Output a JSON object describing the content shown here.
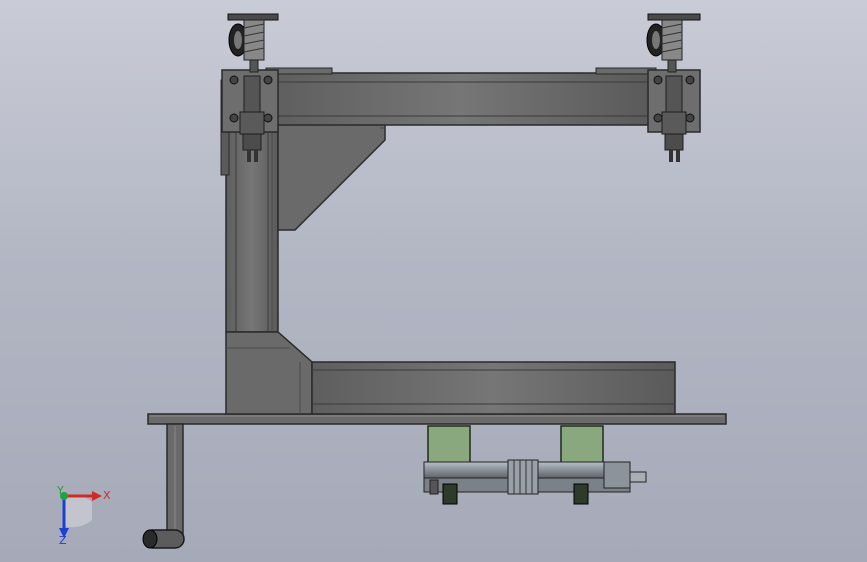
{
  "viewport": {
    "background_top": "#c9ccd6",
    "background_bottom": "#a6aab8"
  },
  "model": {
    "frame_color": "#6d6d6d",
    "frame_edge": "#2c2c2c",
    "cylinder_color": "#9aa0a8",
    "block_color": "#8aa87e"
  },
  "triad": {
    "x_label": "X",
    "y_label": "Y",
    "z_label": "Z",
    "x_color": "#d22828",
    "y_color": "#1fa33a",
    "z_color": "#1f3fd0"
  }
}
